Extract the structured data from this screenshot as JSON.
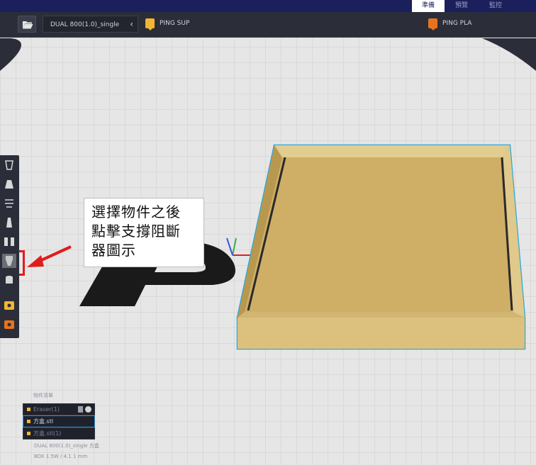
{
  "nav": {
    "tabs": [
      "準備",
      "預覽",
      "監控"
    ],
    "active_tab": 0
  },
  "toolbar": {
    "folder_icon": "folder-open-icon",
    "printer_profile": "DUAL 800(1.0)_single",
    "collapse_chevron": "‹",
    "extruder_left": {
      "label": "PING SUP",
      "color": "#f2b632"
    },
    "extruder_right": {
      "label": "PING PLA",
      "color": "#e8731e"
    }
  },
  "callout": {
    "lines": [
      "選擇物件之後",
      "點擊支撐阻斷",
      "器圖示"
    ]
  },
  "tools": [
    {
      "name": "model-tool-icon"
    },
    {
      "name": "support-tool-icon"
    },
    {
      "name": "mirror-tool-icon"
    },
    {
      "name": "per-model-settings-icon"
    },
    {
      "name": "multi-support-icon"
    },
    {
      "name": "support-blocker-icon"
    },
    {
      "name": "cylinder-tool-icon"
    },
    {
      "name": "extruder-1-icon"
    },
    {
      "name": "extruder-2-icon"
    }
  ],
  "object_panel": {
    "title": "物件清單",
    "items": [
      {
        "label": "Eraser(1)",
        "dim": true
      },
      {
        "label": "方盒.stl",
        "selected": true
      },
      {
        "label": "方盒.stl(1)",
        "dim": true
      }
    ]
  },
  "status": {
    "line1": "DUAL 800(1.0)_single 方盒",
    "line2": "BOX 1.5W / 4.1 1 mm"
  },
  "colors": {
    "nav_bg": "#1b1f5c",
    "toolbar_bg": "#2b2e38",
    "model_fill": "#d2b571",
    "model_outline": "#2ea8d8",
    "highlight": "#e11c1c"
  }
}
